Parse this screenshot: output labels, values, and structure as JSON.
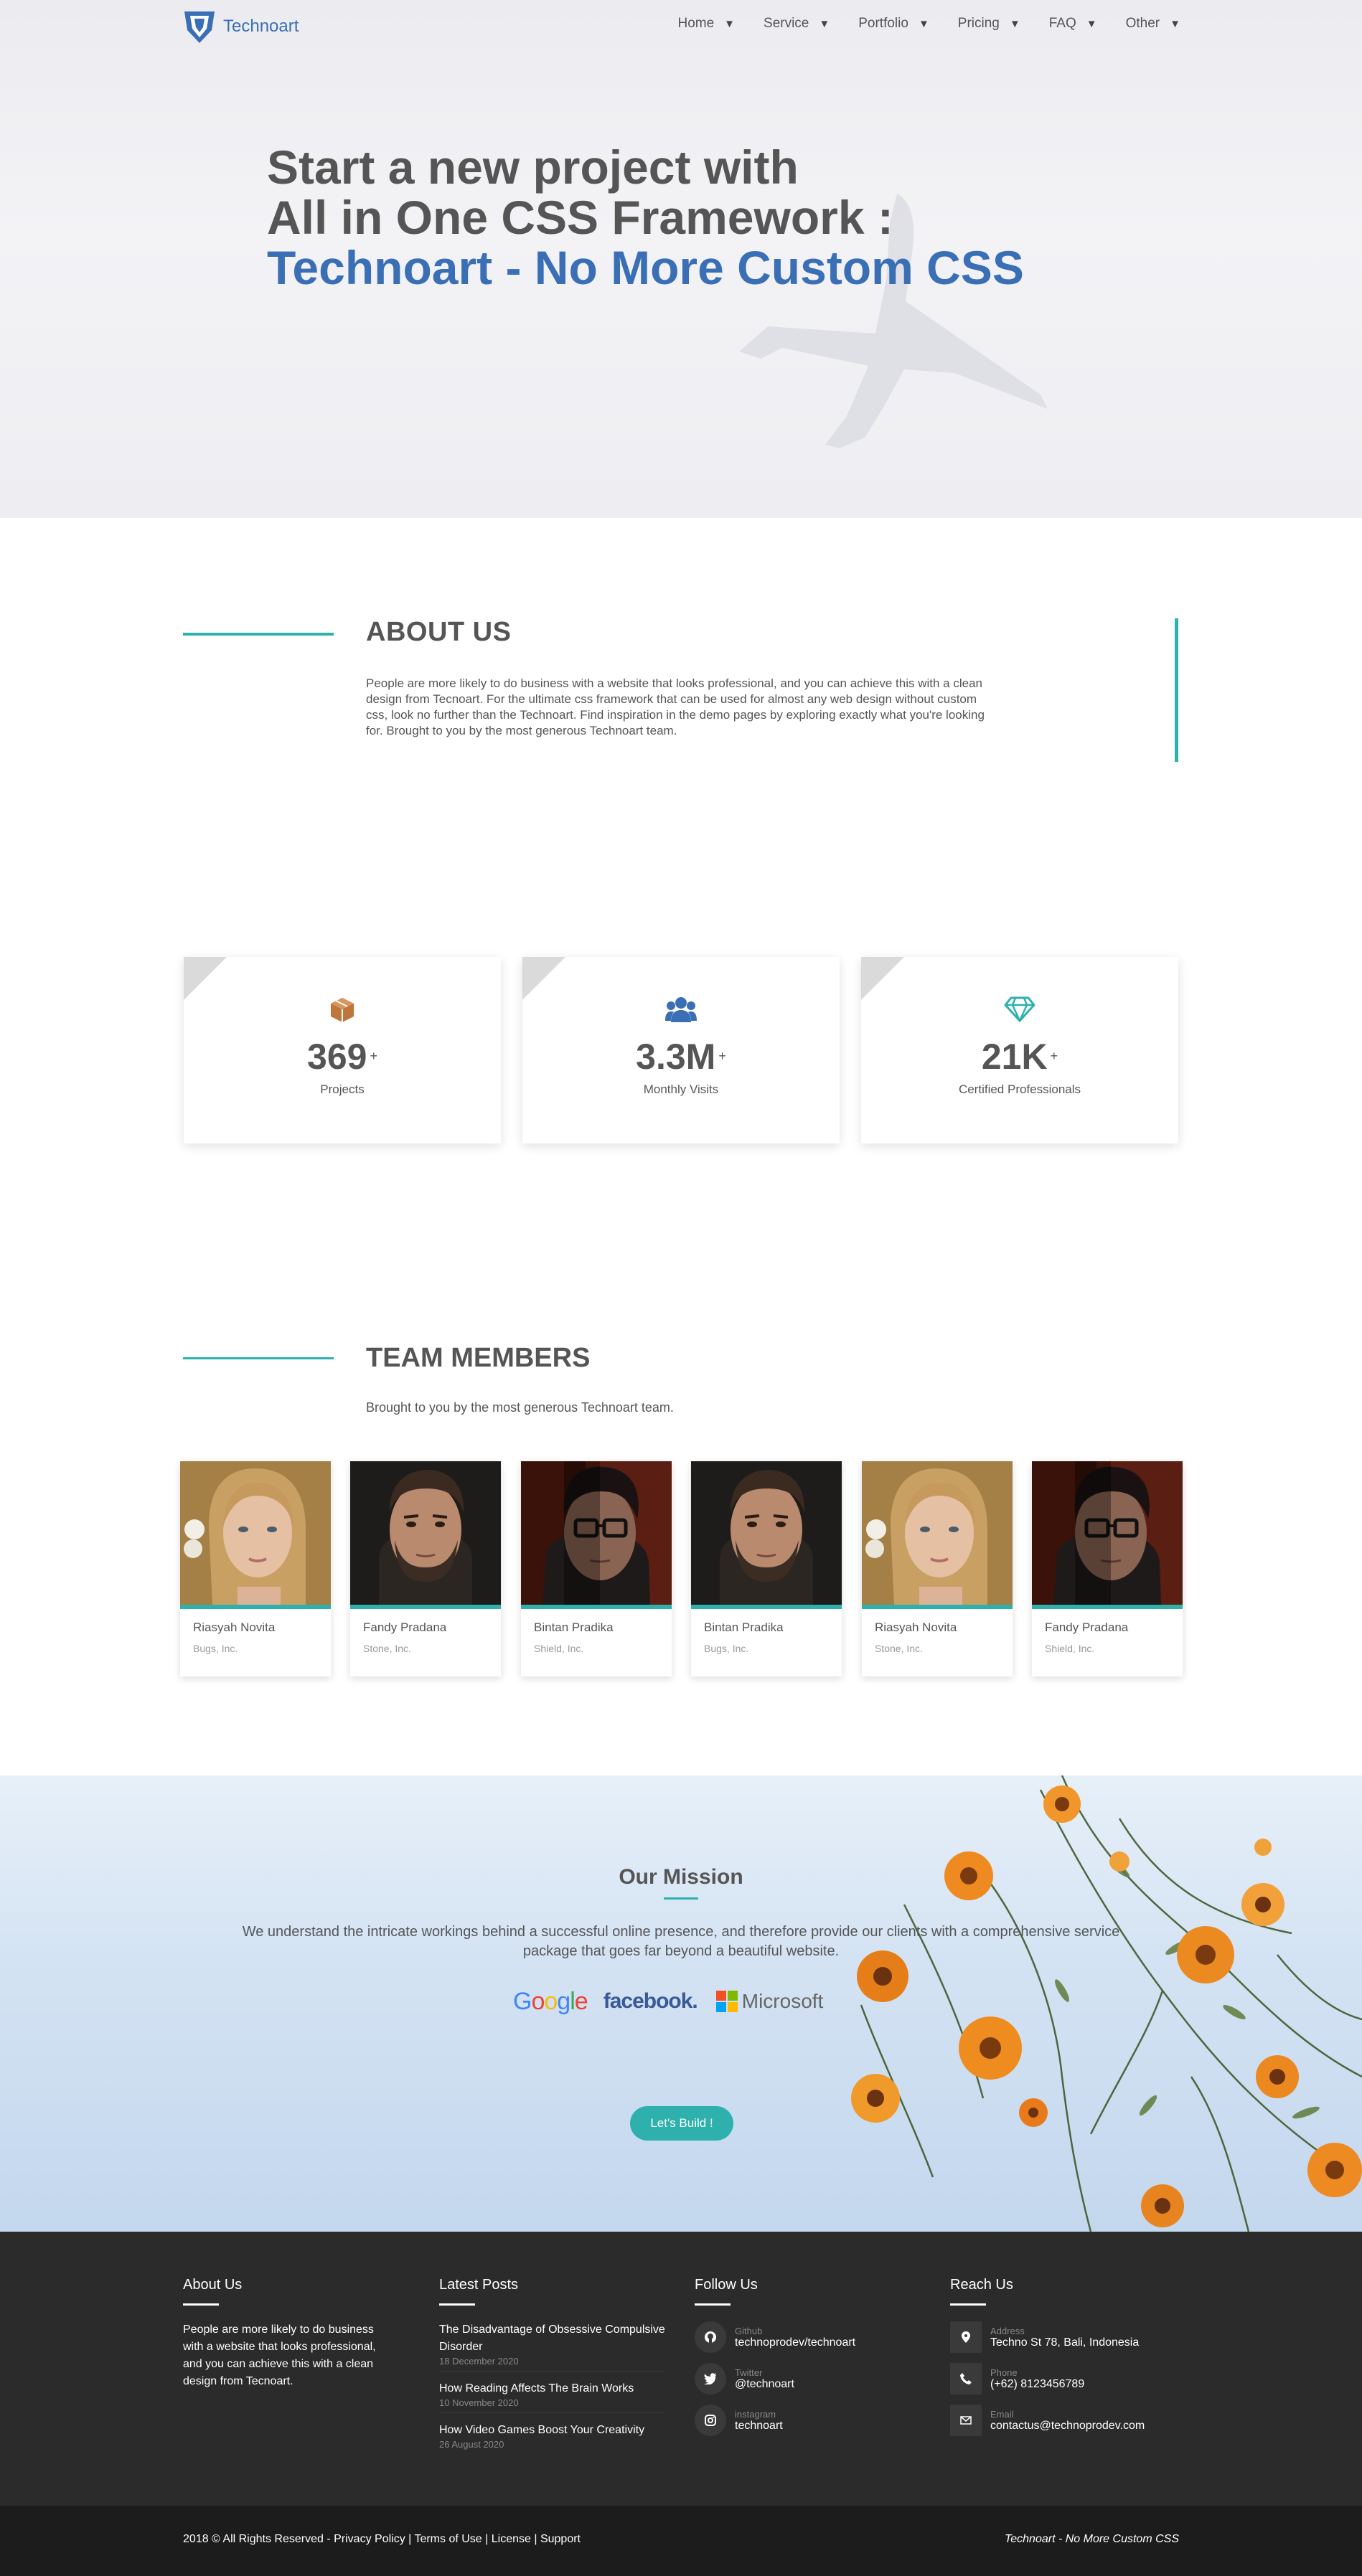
{
  "nav": {
    "brand": "Technoart",
    "items": [
      {
        "label": "Home"
      },
      {
        "label": "Service"
      },
      {
        "label": "Portfolio"
      },
      {
        "label": "Pricing"
      },
      {
        "label": "FAQ"
      },
      {
        "label": "Other"
      }
    ]
  },
  "hero": {
    "line1": "Start a new project with",
    "line2": "All in One CSS Framework :",
    "line3": "Technoart - No More Custom CSS"
  },
  "about": {
    "title": "ABOUT US",
    "text": "People are more likely to do business with a website that looks professional, and you can achieve this with a clean design from Tecnoart. For the ultimate css framework that can be used for almost any web design without custom css, look no further than the Technoart. Find inspiration in the demo pages by exploring exactly what you're looking for. Brought to you by the most generous Technoart team."
  },
  "stats": [
    {
      "value": "369",
      "suffix": "+",
      "label": "Projects",
      "icon": "cube-icon",
      "color": "#c0753a"
    },
    {
      "value": "3.3M",
      "suffix": "+",
      "label": "Monthly Visits",
      "icon": "users-icon",
      "color": "#3a6fb5"
    },
    {
      "value": "21K",
      "suffix": "+",
      "label": "Certified Professionals",
      "icon": "diamond-icon",
      "color": "#2eb1ad"
    }
  ],
  "team": {
    "title": "TEAM MEMBERS",
    "subtitle": "Brought to you by the most generous Technoart team.",
    "members": [
      {
        "name": "Riasyah Novita",
        "company": "Bugs, Inc."
      },
      {
        "name": "Fandy Pradana",
        "company": "Stone, Inc."
      },
      {
        "name": "Bintan Pradika",
        "company": "Shield, Inc."
      },
      {
        "name": "Bintan Pradika",
        "company": "Bugs, Inc."
      },
      {
        "name": "Riasyah Novita",
        "company": "Stone, Inc."
      },
      {
        "name": "Fandy Pradana",
        "company": "Shield, Inc."
      }
    ]
  },
  "mission": {
    "title": "Our Mission",
    "text": "We understand the intricate workings behind a successful online presence, and therefore provide our clients with a comprehensive service package that goes far beyond a beautiful website.",
    "brands": [
      "Google",
      "facebook.",
      "Microsoft"
    ],
    "button": "Let's Build !"
  },
  "footer": {
    "about": {
      "title": "About Us",
      "text": "People are more likely to do business with a website that looks professional, and you can achieve this with a clean design from Tecnoart."
    },
    "posts": {
      "title": "Latest Posts",
      "items": [
        {
          "title": "The Disadvantage of Obsessive Compulsive Disorder",
          "date": "18 December 2020"
        },
        {
          "title": "How Reading Affects The Brain Works",
          "date": "10 November 2020"
        },
        {
          "title": "How Video Games Boost Your Creativity",
          "date": "26 August 2020"
        }
      ]
    },
    "follow": {
      "title": "Follow Us",
      "items": [
        {
          "key": "Github",
          "value": "technoprodev/technoart",
          "icon": "github-icon"
        },
        {
          "key": "Twitter",
          "value": "@technoart",
          "icon": "twitter-icon"
        },
        {
          "key": "instagram",
          "value": "technoart",
          "icon": "instagram-icon"
        }
      ]
    },
    "reach": {
      "title": "Reach Us",
      "items": [
        {
          "key": "Address",
          "value": "Techno St 78, Bali, Indonesia",
          "icon": "map-pin-icon"
        },
        {
          "key": "Phone",
          "value": "(+62) 8123456789",
          "icon": "phone-icon"
        },
        {
          "key": "Email",
          "value": "contactus@technoprodev.com",
          "icon": "envelope-icon"
        }
      ]
    }
  },
  "bottom": {
    "copyright": "2018 © All Rights Reserved - ",
    "links": [
      "Privacy Policy",
      "Terms of Use",
      "License",
      "Support"
    ],
    "separator": " | ",
    "tagline": "Technoart - No More Custom CSS"
  },
  "colors": {
    "accent": "#2eb1ad",
    "brand": "#3a6fb5",
    "footer": "#2b2b2b"
  }
}
